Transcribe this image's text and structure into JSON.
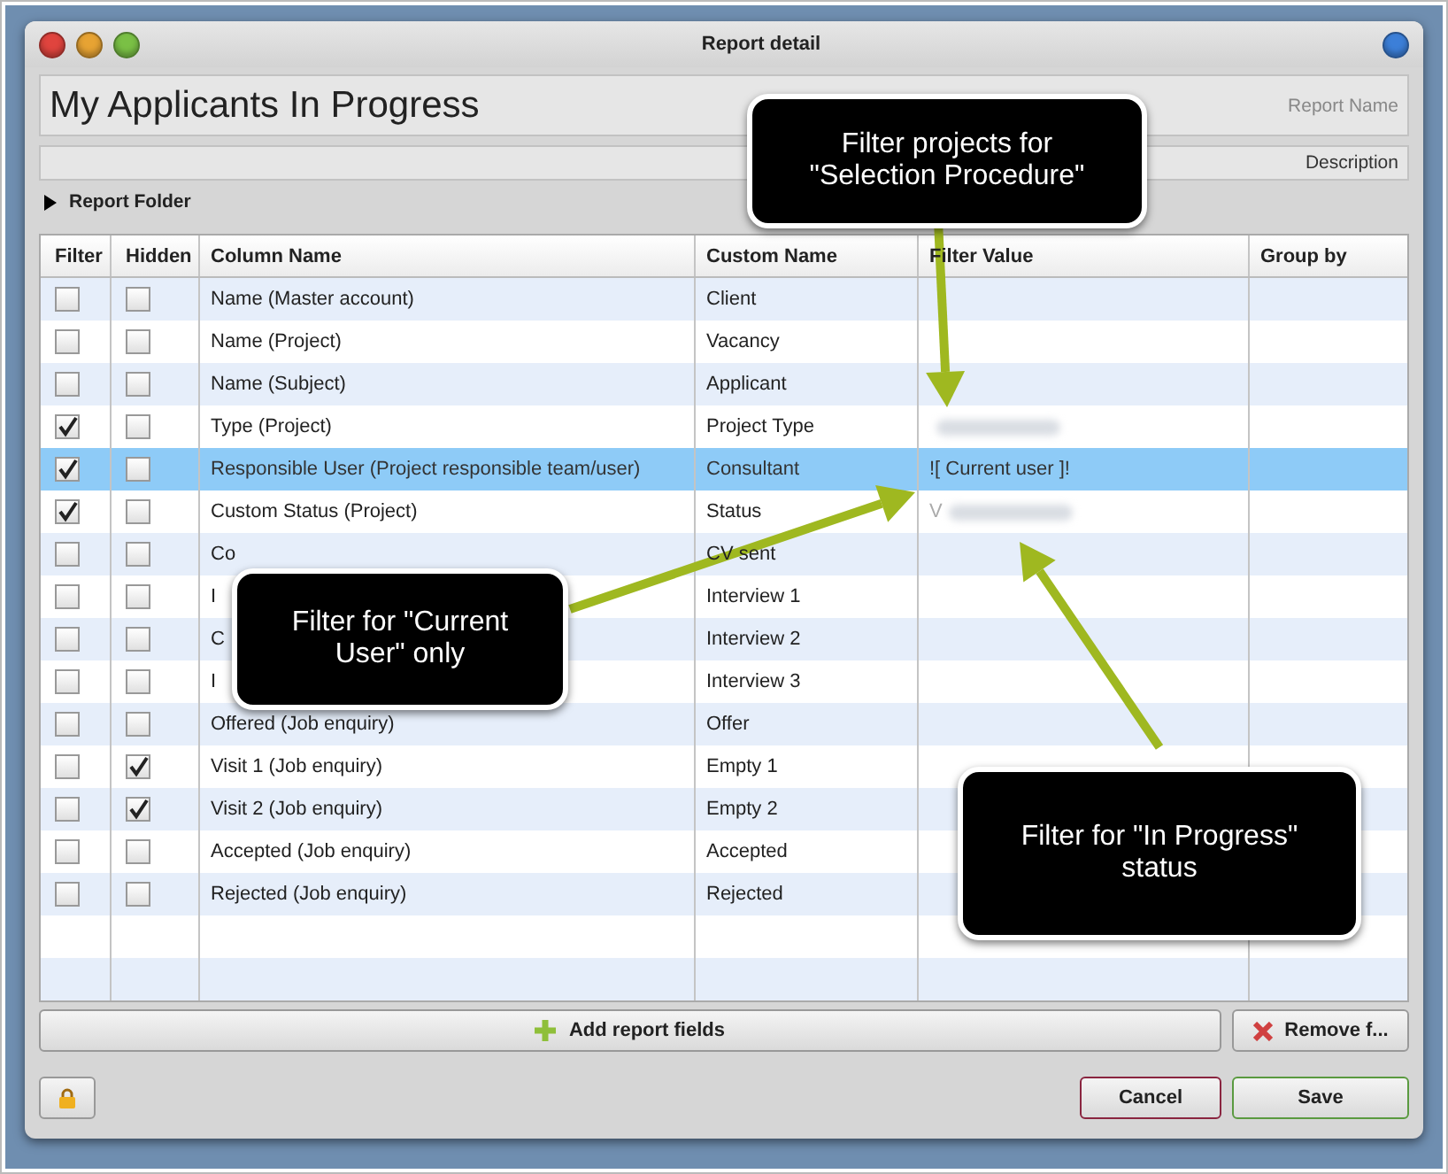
{
  "window": {
    "title": "Report detail"
  },
  "report_name": {
    "value": "My Applicants In Progress",
    "label": "Report Name"
  },
  "description": {
    "label": "Description"
  },
  "report_folder": {
    "label": "Report Folder",
    "expanded": false
  },
  "table": {
    "columns": [
      "Filter",
      "Hidden",
      "Column Name",
      "Custom Name",
      "Filter Value",
      "Group by"
    ],
    "rows": [
      {
        "filter": false,
        "hidden": false,
        "column_name": "Name (Master account)",
        "custom_name": "Client",
        "selected": false
      },
      {
        "filter": false,
        "hidden": false,
        "column_name": "Name (Project)",
        "custom_name": "Vacancy",
        "selected": false
      },
      {
        "filter": false,
        "hidden": false,
        "column_name": "Name (Subject)",
        "custom_name": "Applicant",
        "selected": false
      },
      {
        "filter": true,
        "hidden": false,
        "column_name": "Type (Project)",
        "custom_name": "Project Type",
        "redacted": true,
        "selected": false
      },
      {
        "filter": true,
        "hidden": false,
        "column_name": "Responsible User (Project responsible team/user)",
        "custom_name": "Consultant",
        "filter_value": "![ Current user ]!",
        "selected": true
      },
      {
        "filter": true,
        "hidden": false,
        "column_name": "Custom Status (Project)",
        "custom_name": "Status",
        "filter_value": "V",
        "redacted": true,
        "selected": false
      },
      {
        "filter": false,
        "hidden": false,
        "column_name": "Co",
        "custom_name": "CV sent",
        "selected": false
      },
      {
        "filter": false,
        "hidden": false,
        "column_name": "I",
        "custom_name": "Interview 1",
        "selected": false
      },
      {
        "filter": false,
        "hidden": false,
        "column_name": "C",
        "custom_name": "Interview 2",
        "selected": false
      },
      {
        "filter": false,
        "hidden": false,
        "column_name": "I",
        "custom_name": "Interview 3",
        "selected": false
      },
      {
        "filter": false,
        "hidden": false,
        "column_name": "Offered (Job enquiry)",
        "custom_name": "Offer",
        "selected": false
      },
      {
        "filter": false,
        "hidden": true,
        "column_name": "Visit 1 (Job enquiry)",
        "custom_name": "Empty 1",
        "selected": false
      },
      {
        "filter": false,
        "hidden": true,
        "column_name": "Visit 2 (Job enquiry)",
        "custom_name": "Empty 2",
        "selected": false
      },
      {
        "filter": false,
        "hidden": false,
        "column_name": "Accepted (Job enquiry)",
        "custom_name": "Accepted",
        "selected": false
      },
      {
        "filter": false,
        "hidden": false,
        "column_name": "Rejected (Job enquiry)",
        "custom_name": "Rejected",
        "selected": false
      }
    ]
  },
  "buttons": {
    "add": "Add report fields",
    "remove": "Remove f...",
    "cancel": "Cancel",
    "save": "Save"
  },
  "callouts": [
    {
      "text": "Filter projects for\n\"Selection Procedure\""
    },
    {
      "text": "Filter for \"Current\nUser\" only"
    },
    {
      "text": "Filter for \"In Progress\"\nstatus"
    }
  ]
}
